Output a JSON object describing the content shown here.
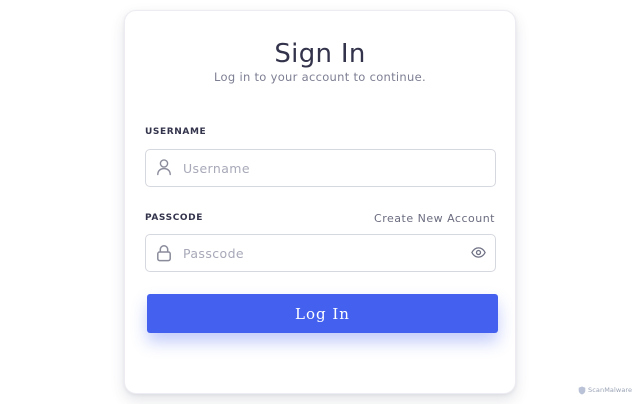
{
  "login": {
    "title": "Sign In",
    "subtitle": "Log in to your account to continue.",
    "username": {
      "label": "USERNAME",
      "placeholder": "Username",
      "value": "",
      "icon": "user-icon"
    },
    "passcode": {
      "label": "PASSCODE",
      "placeholder": "Passcode",
      "value": "",
      "icon": "lock-icon",
      "toggle_icon": "eye-icon"
    },
    "create_account_label": "Create New Account",
    "submit_label": "Log In"
  },
  "colors": {
    "accent": "#4361ee",
    "heading": "#33344c",
    "muted": "#7d7f93",
    "border": "#d6d8e0"
  },
  "watermark": {
    "text": "ScanMalware"
  }
}
